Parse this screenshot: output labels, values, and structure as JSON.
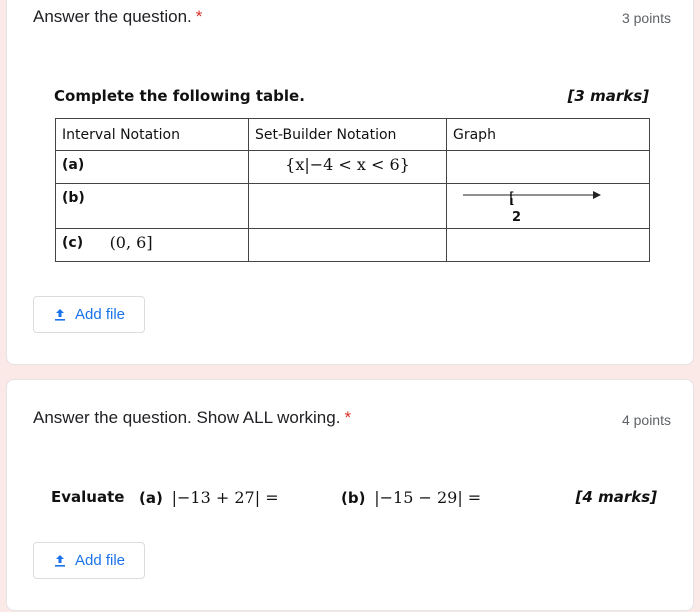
{
  "question1": {
    "title": "Answer the question.",
    "required_mark": "*",
    "points": "3 points",
    "heading": "Complete the following table.",
    "marks": "[3 marks]",
    "table": {
      "headers": [
        "Interval Notation",
        "Set-Builder Notation",
        "Graph"
      ],
      "rows": [
        {
          "label": "(a)",
          "interval": "",
          "setbuilder": "{x|−4 < x < 6}"
        },
        {
          "label": "(b)",
          "interval": "",
          "setbuilder": "",
          "graph_bracket": "[",
          "graph_number": "2"
        },
        {
          "label": "(c)",
          "interval": "(0, 6]",
          "setbuilder": ""
        }
      ]
    },
    "add_file_label": "Add file"
  },
  "question2": {
    "title": "Answer the question. Show ALL working.",
    "required_mark": "*",
    "points": "4 points",
    "evaluate_word": "Evaluate",
    "part_a_label": "(a)",
    "part_a_expr": "|−13 + 27| =",
    "part_b_label": "(b)",
    "part_b_expr": "|−15 − 29| =",
    "marks": "[4 marks]",
    "add_file_label": "Add file"
  },
  "colors": {
    "page_background": "#fbe9e7",
    "required": "#d93025",
    "accent_blue": "#1a73e8"
  },
  "icons": {
    "upload": "upload-icon"
  }
}
